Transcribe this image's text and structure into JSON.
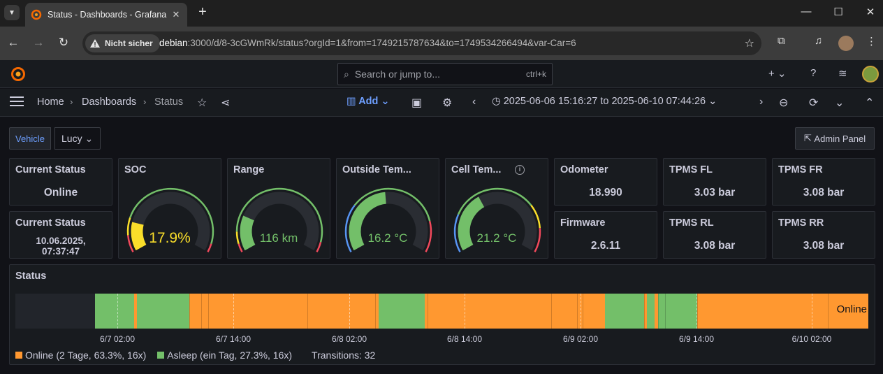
{
  "browser": {
    "tab_title": "Status - Dashboards - Grafana",
    "not_secure_label": "Nicht sicher",
    "url_host": "debian",
    "url_rest": ":3000/d/8-3cGWmRk/status?orgId=1&from=1749215787634&to=1749534266494&var-Car=6"
  },
  "grafana": {
    "search_placeholder": "Search or jump to...",
    "search_shortcut": "ctrl+k",
    "breadcrumb": [
      "Home",
      "Dashboards",
      "Status"
    ],
    "add_label": "Add",
    "time_range": "2025-06-06 15:16:27 to 2025-06-10 07:44:26",
    "variable_label": "Vehicle",
    "variable_value": "Lucy",
    "admin_panel_label": "Admin Panel"
  },
  "panels": {
    "current_status": {
      "title": "Current Status",
      "value": "Online"
    },
    "current_status_time": {
      "title": "Current Status",
      "value_line1": "10.06.2025,",
      "value_line2": "07:37:47"
    },
    "soc": {
      "title": "SOC",
      "value": "17.9%",
      "percent": 17.9,
      "color": "#fade2a"
    },
    "range": {
      "title": "Range",
      "value": "116 km",
      "fraction": 0.22,
      "color": "#73bf69"
    },
    "outside_temp": {
      "title": "Outside Tem...",
      "value": "16.2 °C",
      "fraction": 0.48,
      "color": "#73bf69"
    },
    "cell_temp": {
      "title": "Cell Tem...",
      "value": "21.2 °C",
      "fraction": 0.38,
      "color": "#73bf69"
    },
    "odometer": {
      "title": "Odometer",
      "value": "18.990"
    },
    "firmware": {
      "title": "Firmware",
      "value": "2.6.11"
    },
    "tpms_fl": {
      "title": "TPMS FL",
      "value": "3.03 bar"
    },
    "tpms_fr": {
      "title": "TPMS FR",
      "value": "3.08 bar"
    },
    "tpms_rl": {
      "title": "TPMS RL",
      "value": "3.08 bar"
    },
    "tpms_rr": {
      "title": "TPMS RR",
      "value": "3.08 bar"
    }
  },
  "status_timeline": {
    "title": "Status",
    "end_label": "Online",
    "ticks": [
      "6/7 02:00",
      "6/7 14:00",
      "6/8 02:00",
      "6/8 14:00",
      "6/9 02:00",
      "6/9 14:00",
      "6/10 02:00"
    ],
    "legend": [
      {
        "label": "Online (2 Tage, 63.3%, 16x)",
        "color": "#ff9830"
      },
      {
        "label": "Asleep (ein Tag, 27.3%, 16x)",
        "color": "#73bf69"
      }
    ],
    "transitions": "Transitions: 32",
    "colors": {
      "online": "#ff9830",
      "asleep": "#73bf69",
      "no_data": "#22252b"
    }
  }
}
